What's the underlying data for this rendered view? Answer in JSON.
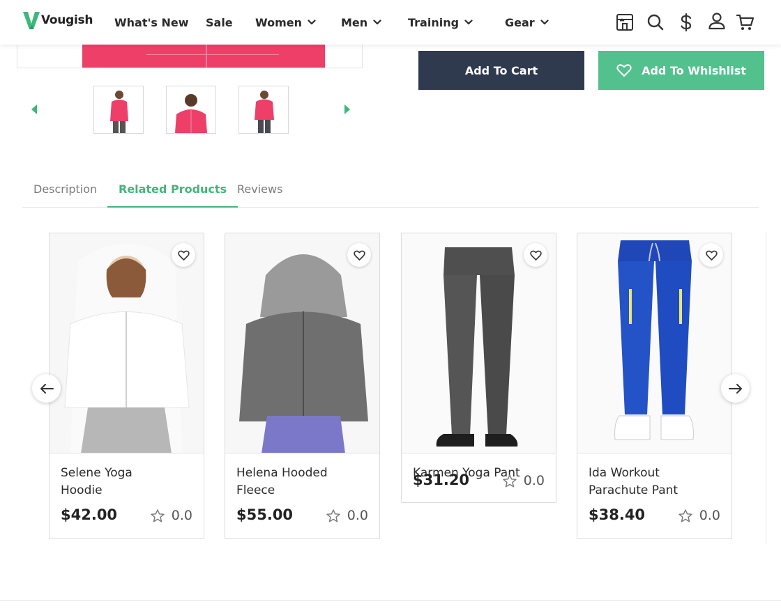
{
  "header": {
    "logo_text": "Vougish",
    "nav": [
      {
        "label": "What's New",
        "has_dropdown": false
      },
      {
        "label": "Sale",
        "has_dropdown": false
      },
      {
        "label": "Women",
        "has_dropdown": true
      },
      {
        "label": "Men",
        "has_dropdown": true
      },
      {
        "label": "Training",
        "has_dropdown": true
      },
      {
        "label": "Gear",
        "has_dropdown": true
      }
    ],
    "icons": [
      "store-icon",
      "search-icon",
      "currency-dollar-icon",
      "user-icon",
      "cart-icon"
    ]
  },
  "product": {
    "add_to_cart_label": "Add To Cart",
    "add_to_wishlist_label": "Add To Whishlist",
    "image_color": "#ee3f69"
  },
  "tabs": [
    {
      "label": "Description",
      "active": false
    },
    {
      "label": "Related Products",
      "active": true
    },
    {
      "label": "Reviews",
      "active": false
    }
  ],
  "related_products": [
    {
      "name": "Selene Yoga Hoodie",
      "price": "$42.00",
      "rating": "0.0"
    },
    {
      "name": "Helena Hooded Fleece",
      "price": "$55.00",
      "rating": "0.0"
    },
    {
      "name": "Karmen Yoga Pant",
      "price": "$31.20",
      "rating": "0.0"
    },
    {
      "name": "Ida Workout Parachute Pant",
      "price": "$38.40",
      "rating": "0.0"
    }
  ],
  "colors": {
    "accent": "#3cb87a",
    "wishlist_button": "#52c18e",
    "cart_button": "#2f3a4f"
  }
}
